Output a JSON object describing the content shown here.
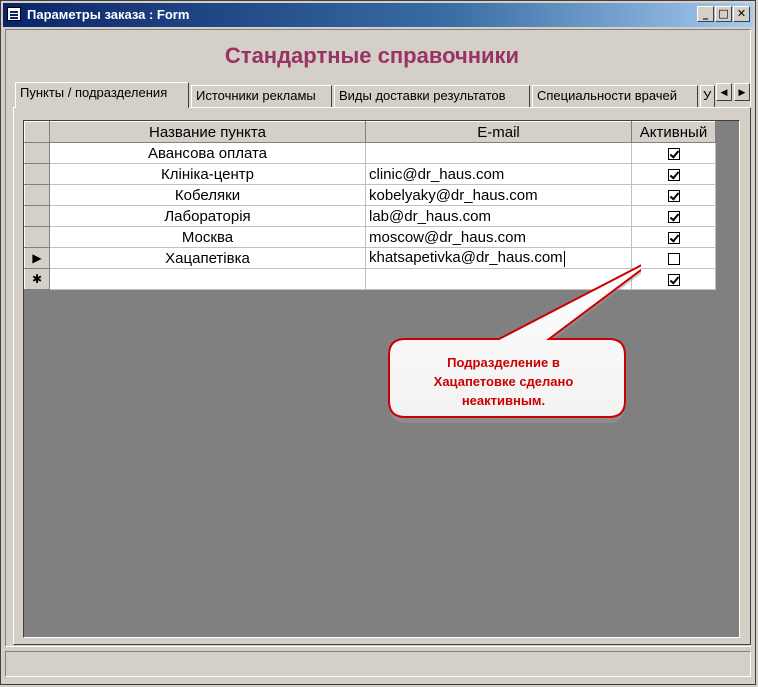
{
  "window": {
    "title": "Параметры заказа : Form",
    "min_label": "_",
    "max_label": "□",
    "close_label": "✕"
  },
  "form": {
    "heading": "Стандартные справочники"
  },
  "tabs": [
    {
      "label": "Пункты / подразделения",
      "active": true
    },
    {
      "label": "Источники рекламы"
    },
    {
      "label": "Виды доставки результатов"
    },
    {
      "label": "Специальности врачей"
    },
    {
      "label": "У"
    }
  ],
  "tab_scroll": {
    "left": "◀",
    "right": "▶"
  },
  "table": {
    "columns": [
      "Название пункта",
      "E-mail",
      "Активный"
    ],
    "rows": [
      {
        "name": "Авансова оплата",
        "email": "",
        "active": true
      },
      {
        "name": "Клініка-центр",
        "email": "clinic@dr_haus.com",
        "active": true
      },
      {
        "name": "Кобеляки",
        "email": "kobelyaky@dr_haus.com",
        "active": true
      },
      {
        "name": "Лабораторія",
        "email": "lab@dr_haus.com",
        "active": true
      },
      {
        "name": "Москва",
        "email": "moscow@dr_haus.com",
        "active": true
      },
      {
        "name": "Хацапетівка",
        "email": "khatsapetivka@dr_haus.com",
        "active": false
      }
    ],
    "current_marker": "▶",
    "new_marker": "✱",
    "new_row_active": true
  },
  "callout": {
    "line1": "Подразделение в",
    "line2": "Хацапетовке сделано",
    "line3": "неактивным."
  }
}
